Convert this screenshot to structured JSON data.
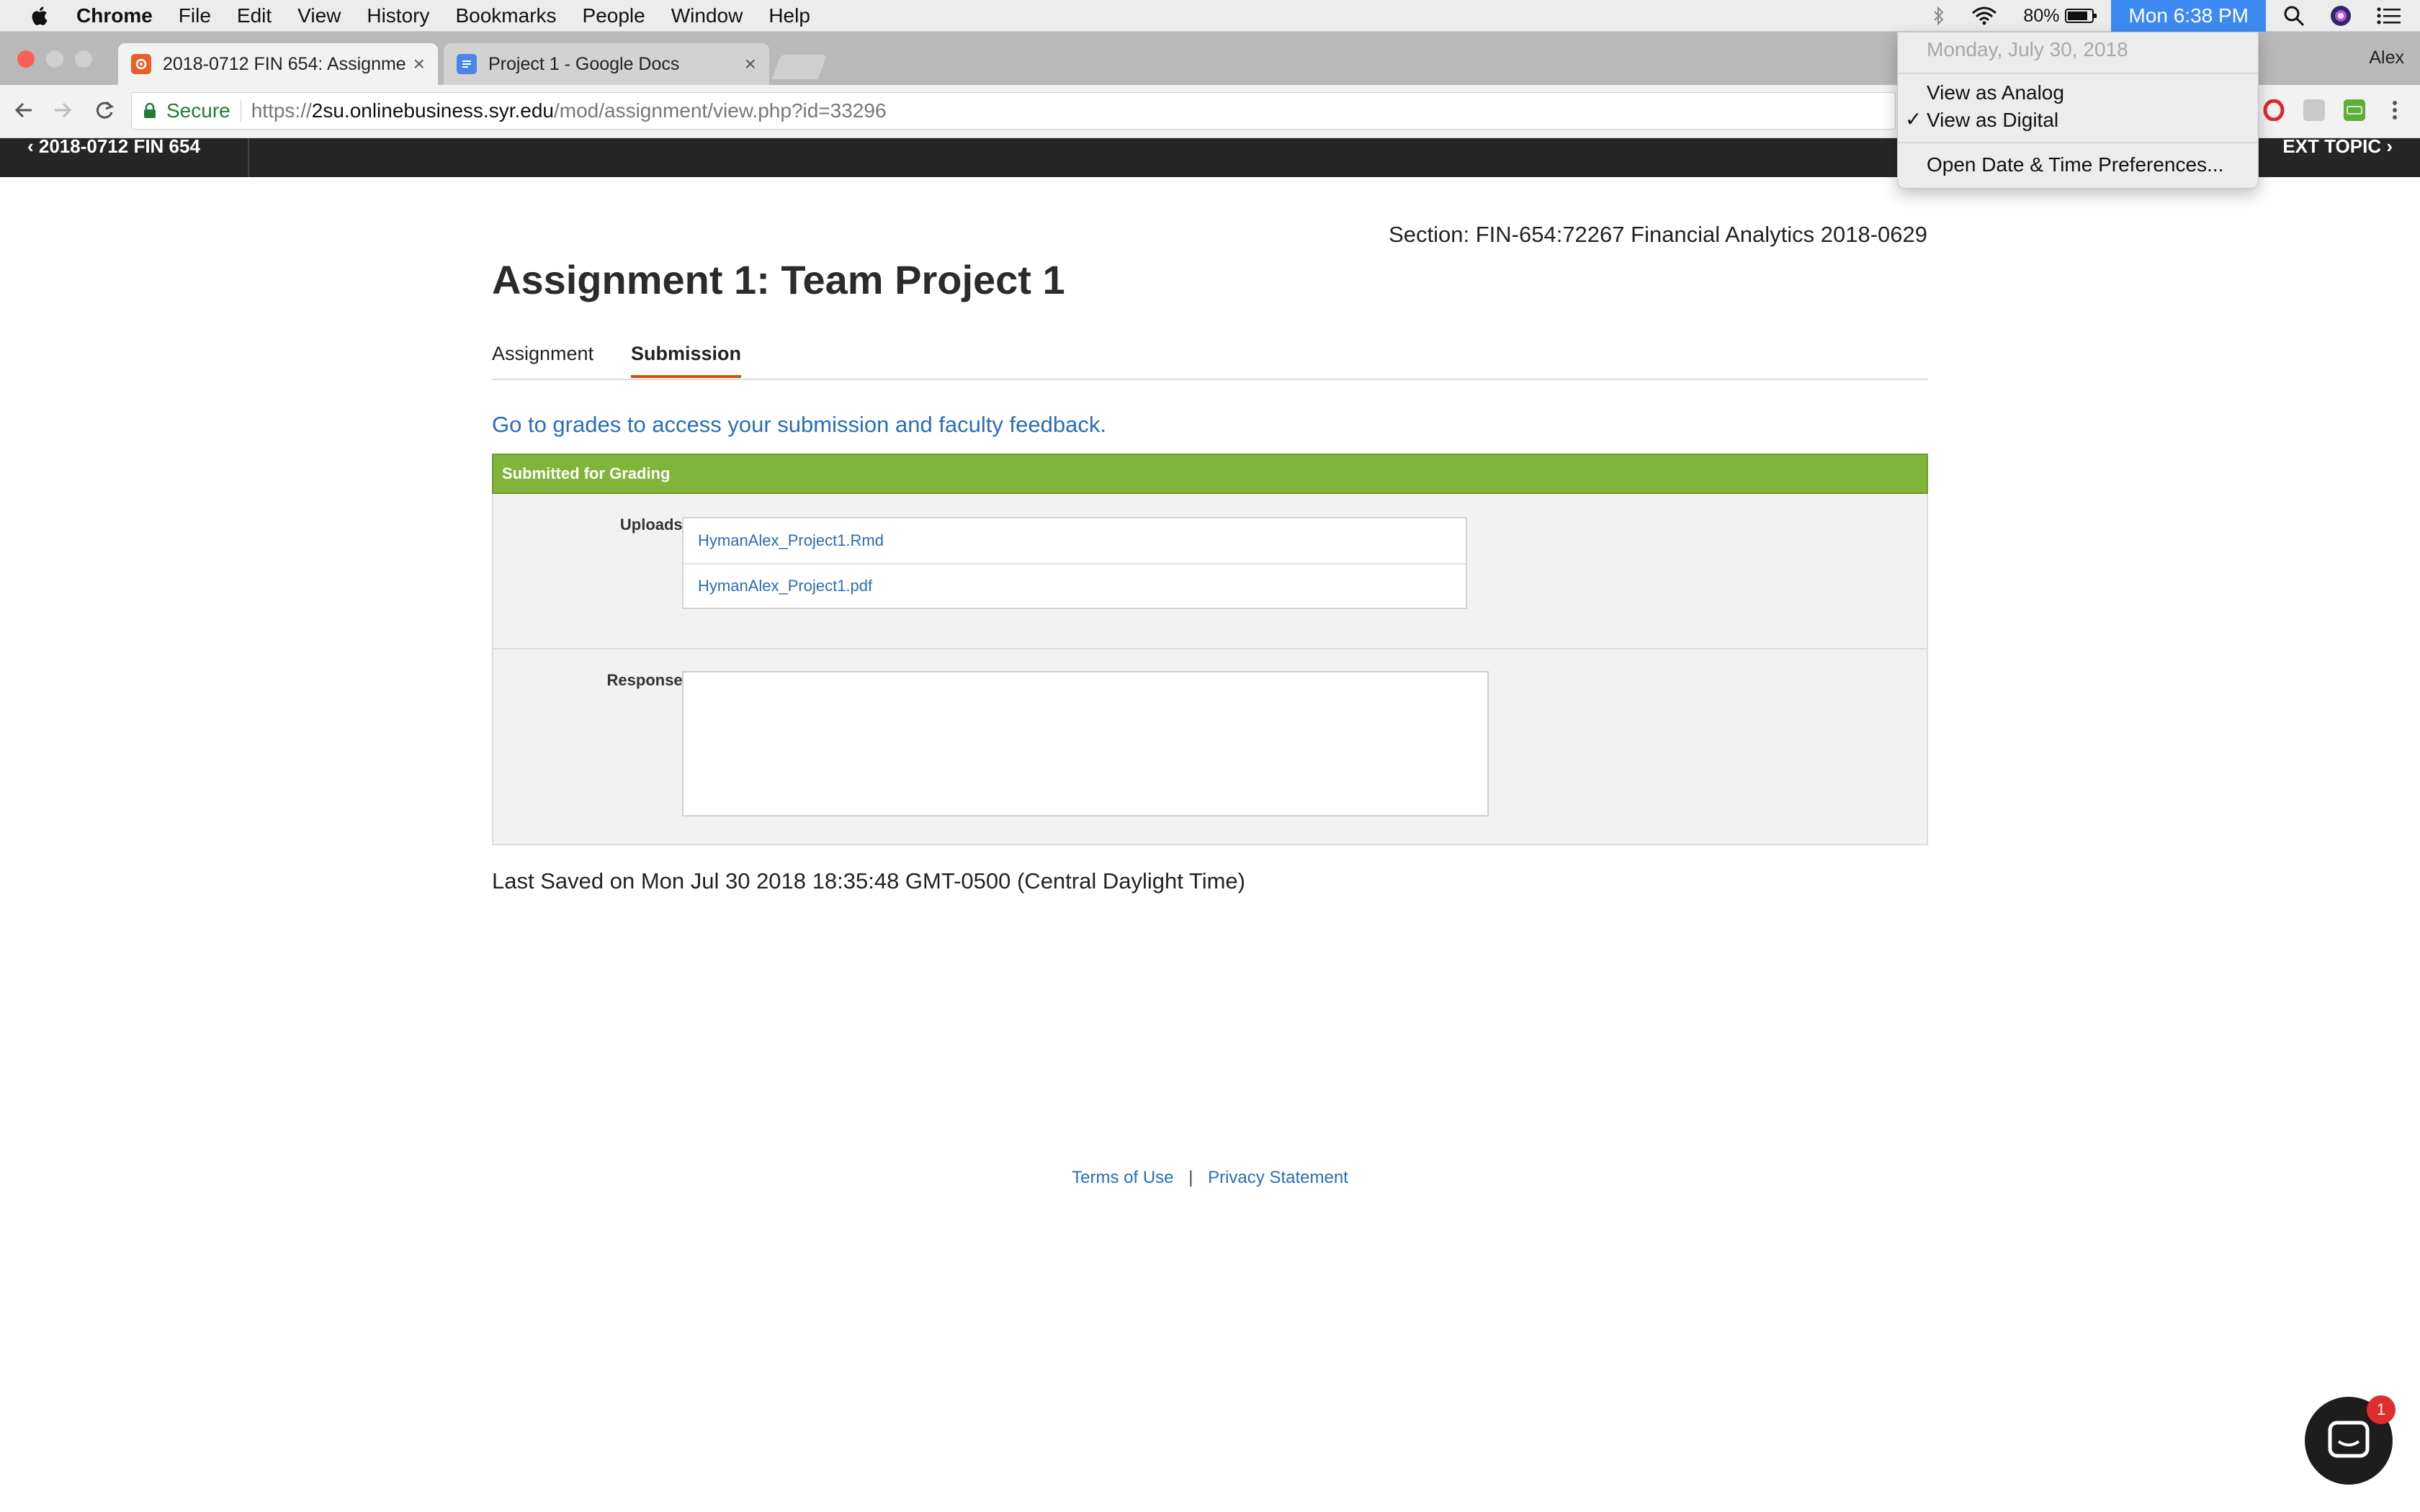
{
  "menubar": {
    "app": "Chrome",
    "items": [
      "File",
      "Edit",
      "View",
      "History",
      "Bookmarks",
      "People",
      "Window",
      "Help"
    ],
    "battery": "80%",
    "clock": "Mon 6:38 PM"
  },
  "browser": {
    "tabs": [
      {
        "title": "2018-0712 FIN 654: Assignme",
        "close": "×"
      },
      {
        "title": "Project 1 - Google Docs",
        "close": "×"
      }
    ],
    "user": "Alex",
    "secure_label": "Secure",
    "url_scheme": "https://",
    "url_host": "2su.onlinebusiness.syr.edu",
    "url_path": "/mod/assignment/view.php?id=33296"
  },
  "topic_bar": {
    "prev": "‹  2018-0712 FIN 654",
    "next": "EXT TOPIC  ›"
  },
  "page": {
    "section": "Section: FIN-654:72267 Financial Analytics 2018-0629",
    "title": "Assignment 1: Team Project 1",
    "tabs": [
      "Assignment",
      "Submission"
    ],
    "active_tab": "Submission",
    "grades_link": "Go to grades to access your submission and faculty feedback.",
    "status": "Submitted for Grading",
    "uploads_label": "Uploads:",
    "files": [
      "HymanAlex_Project1.Rmd",
      "HymanAlex_Project1.pdf"
    ],
    "response_label": "Response:",
    "last_saved": "Last Saved on Mon Jul 30 2018 18:35:48 GMT-0500 (Central Daylight Time)"
  },
  "footer": {
    "terms": "Terms of Use",
    "separator": "|",
    "privacy": "Privacy Statement"
  },
  "chat": {
    "badge": "1"
  },
  "clock_menu": {
    "date": "Monday, July 30, 2018",
    "analog": "View as Analog",
    "digital": "View as Digital",
    "checkmark": "✓",
    "preferences": "Open Date & Time Preferences..."
  },
  "colors": {
    "accent_blue": "#3d8bf2",
    "link_blue": "#2a6eb5",
    "status_green": "#80b53a",
    "active_tab_underline": "#d35400"
  }
}
